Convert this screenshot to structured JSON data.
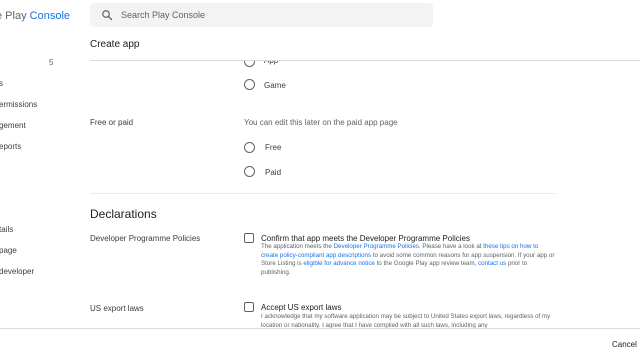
{
  "brand": {
    "prefix": "e Play ",
    "accent": "Console"
  },
  "sidebar": {
    "badge": "5",
    "items": [
      {
        "label": "s"
      },
      {
        "label": "ermissions"
      },
      {
        "label": "gement"
      },
      {
        "label": "eports"
      },
      {
        "label": "tails"
      },
      {
        "label": "page"
      },
      {
        "label": " developer"
      }
    ]
  },
  "search": {
    "placeholder": "Search Play Console"
  },
  "page": {
    "title": "Create app"
  },
  "app_or_game": {
    "options": [
      {
        "label": "App",
        "selected": false
      },
      {
        "label": "Game",
        "selected": false
      }
    ]
  },
  "free_or_paid": {
    "label": "Free or paid",
    "helper": "You can edit this later on the paid app page",
    "options": [
      {
        "label": "Free",
        "selected": false
      },
      {
        "label": "Paid",
        "selected": false
      }
    ]
  },
  "declarations": {
    "heading": "Declarations",
    "policies": {
      "label": "Developer Programme Policies",
      "checkbox_label": "Confirm that app meets the Developer Programme Policies",
      "checked": false,
      "desc": {
        "t1": "The application meets the ",
        "l1": "Developer Programme Policies",
        "t2": ". Please have a look at ",
        "l2": "these tips on how to create policy-compliant app descriptions",
        "t3": " to avoid some common reasons for app suspension. If your app or Store Listing is ",
        "l3": "eligible for advance notice",
        "t4": " to the Google Play app review team, ",
        "l4": "contact us",
        "t5": " prior to publishing."
      }
    },
    "export": {
      "label": "US export laws",
      "checkbox_label": "Accept US export laws",
      "checked": false,
      "desc": "I acknowledge that my software application may be subject to United States export laws, regardless of my location or nationality. I agree that I have complied with all such laws, including any"
    }
  },
  "footer": {
    "cancel_label": "Cancel"
  },
  "colors": {
    "accent": "#1a73e8",
    "text": "#202124",
    "muted": "#5f6368",
    "divider": "#dadce0"
  }
}
